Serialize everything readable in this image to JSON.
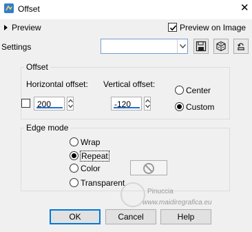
{
  "window": {
    "title": "Offset",
    "close_glyph": "✕",
    "app_icon": "app-icon"
  },
  "preview": {
    "label": "Preview",
    "preview_on_image_label": "Preview on Image",
    "preview_on_image_checked": true
  },
  "settings": {
    "label": "Settings",
    "combo_value": ""
  },
  "offset_group": {
    "title": "Offset",
    "horizontal_label": "Horizontal offset:",
    "horizontal_value": "200",
    "vertical_label": "Vertical offset:",
    "vertical_value": "-120",
    "link_checked": false,
    "center_label": "Center",
    "custom_label": "Custom",
    "selected": "Custom"
  },
  "edge_mode": {
    "title": "Edge mode",
    "options": [
      "Wrap",
      "Repeat",
      "Color",
      "Transparent"
    ],
    "selected": "Repeat"
  },
  "buttons": {
    "ok": "OK",
    "cancel": "Cancel",
    "help": "Help"
  },
  "watermark": {
    "title": "Pinuccia",
    "url": "www.maidiregrafica.eu"
  },
  "colors": {
    "accent": "#0078d7",
    "spin_underline": "#1c6ed6"
  }
}
